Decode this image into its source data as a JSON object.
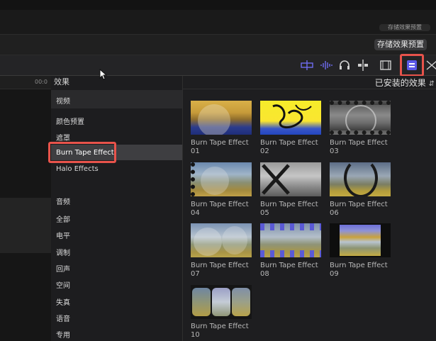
{
  "header": {
    "top_right_pill": "存储效果预置",
    "save_preset_label": "存储效果预置"
  },
  "toolbar": {
    "icons": [
      "video-scope-icon",
      "audio-meter-icon",
      "headphones-icon",
      "skimming-icon",
      "filmstrip-icon",
      "effects-browser-icon",
      "transitions-icon"
    ]
  },
  "timeline": {
    "ruler_label": "00:0"
  },
  "sidebar": {
    "title": "效果",
    "sections": {
      "video": "视频",
      "audio": "音频"
    },
    "video_items": [
      "颜色预置",
      "遮罩",
      "Burn Tape Effect",
      "Halo Effects"
    ],
    "audio_items": [
      "全部",
      "电平",
      "调制",
      "回声",
      "空间",
      "失真",
      "语音",
      "专用"
    ],
    "selected": "Burn Tape Effect"
  },
  "browser": {
    "filter_label": "已安装的效果",
    "effects": [
      {
        "name": "Burn Tape Effect",
        "num": "01"
      },
      {
        "name": "Burn Tape Effect",
        "num": "02"
      },
      {
        "name": "Burn Tape Effect",
        "num": "03"
      },
      {
        "name": "Burn Tape Effect",
        "num": "04"
      },
      {
        "name": "Burn Tape Effect",
        "num": "05"
      },
      {
        "name": "Burn Tape Effect",
        "num": "06"
      },
      {
        "name": "Burn Tape Effect",
        "num": "07"
      },
      {
        "name": "Burn Tape Effect",
        "num": "08"
      },
      {
        "name": "Burn Tape Effect",
        "num": "09"
      },
      {
        "name": "Burn Tape Effect",
        "num": "10"
      }
    ]
  },
  "colors": {
    "highlight": "#e8534b",
    "accent_icon": "#6f6cf0"
  }
}
